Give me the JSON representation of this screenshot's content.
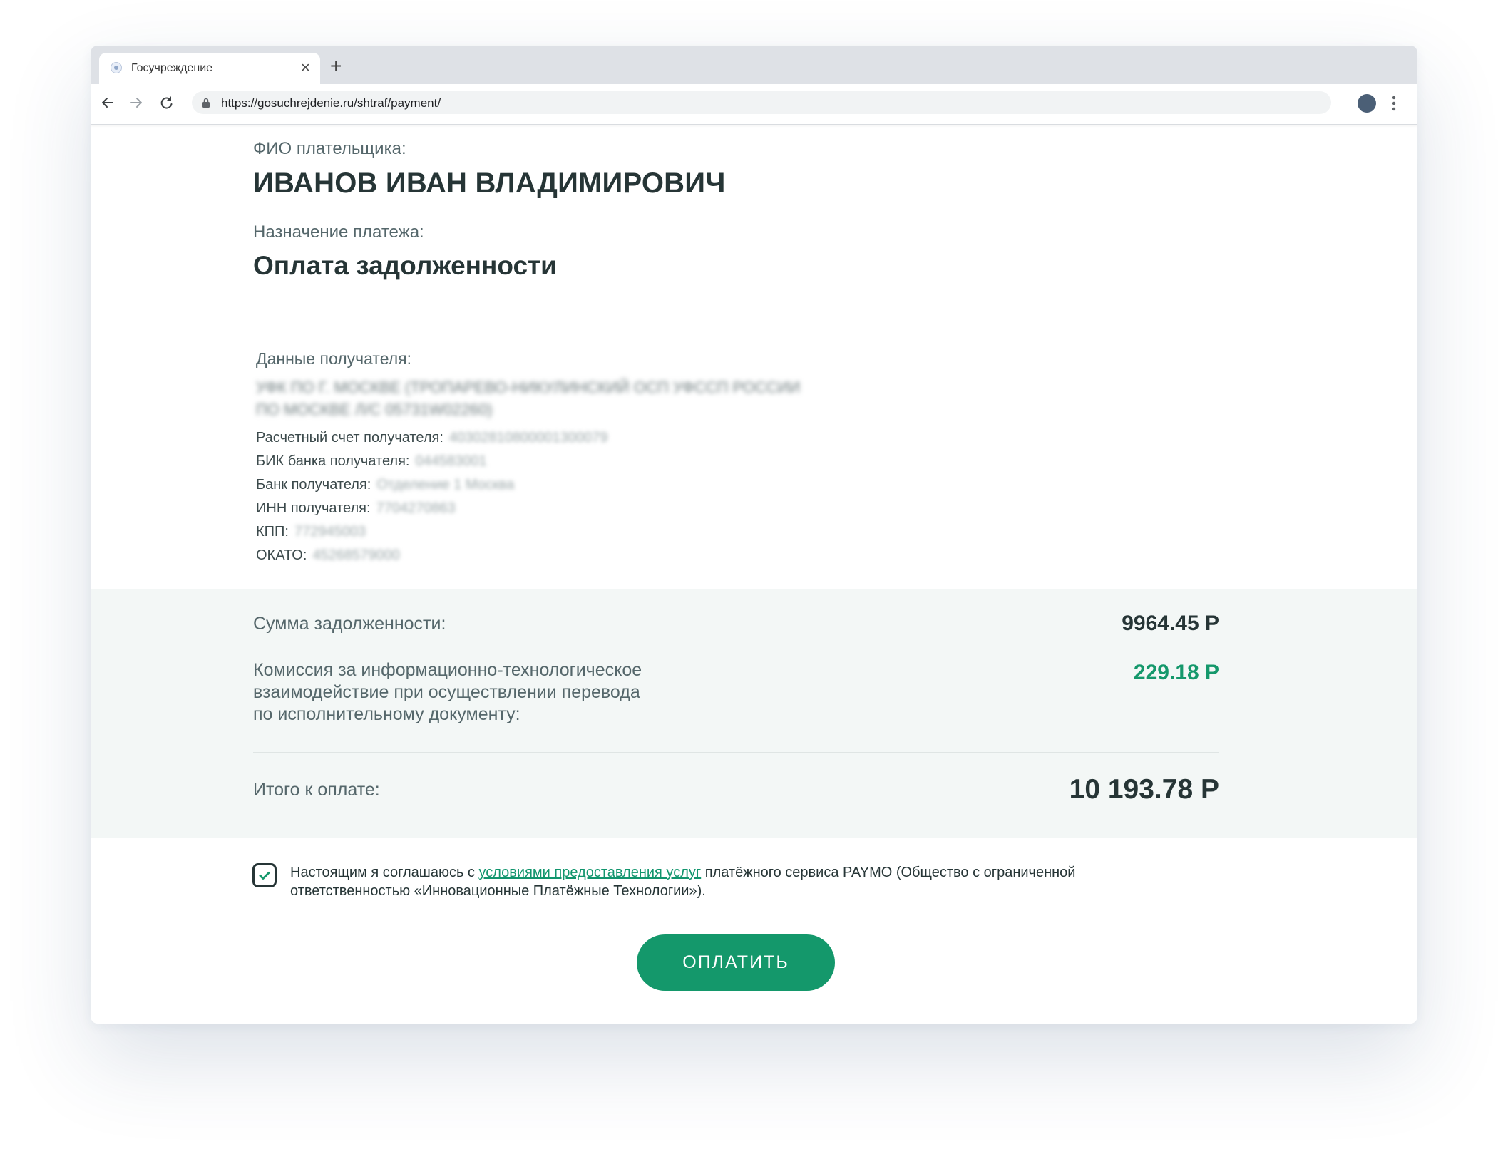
{
  "browser": {
    "tab_title": "Госучреждение",
    "tab_close": "×",
    "new_tab": "+",
    "url": "https://gosuchrejdenie.ru/shtraf/payment/"
  },
  "payer": {
    "label": "ФИО плательщика:",
    "name": "ИВАНОВ ИВАН ВЛАДИМИРОВИЧ"
  },
  "purpose": {
    "label": "Назначение платежа:",
    "value": "Оплата задолженности"
  },
  "recipient": {
    "title": "Данные получателя:",
    "name_line1": "УФК ПО Г. МОСКВЕ (ТРОПАРЕВО-НИКУЛИНСКИЙ ОСП УФССП РОССИИ",
    "name_line2": "ПО МОСКВЕ Л/С 05731W02260)",
    "fields": [
      {
        "label": "Расчетный счет получателя:",
        "value": "40302810800001300079"
      },
      {
        "label": "БИК банка получателя:",
        "value": "044583001"
      },
      {
        "label": "Банк получателя:",
        "value": "Отделение 1 Москва"
      },
      {
        "label": "ИНН получателя:",
        "value": "7704270863"
      },
      {
        "label": "КПП:",
        "value": "772945003"
      },
      {
        "label": "ОКАТО:",
        "value": "45268579000"
      }
    ]
  },
  "summary": {
    "debt_label": "Сумма задолженности:",
    "debt_value": "9964.45 Р",
    "commission_line1": "Комиссия за информационно-технологическое",
    "commission_line2": "взаимодействие при осуществлении перевода",
    "commission_line3": "по исполнительному документу:",
    "commission_value": "229.18 Р",
    "total_label": "Итого к оплате:",
    "total_value": "10 193.78 Р"
  },
  "agreement": {
    "checked": true,
    "text_before": "Настоящим я соглашаюсь с ",
    "link_text": "условиями предоставления услуг",
    "text_after": " платёжного сервиса PAYMO (Общество с ограниченной ответственностью «Инновационные Платёжные Технологии»)."
  },
  "pay_button_label": "ОПЛАТИТЬ",
  "colors": {
    "accent": "#14986b",
    "commission": "#14986b",
    "summary_bg": "#f3f7f6",
    "text_dark": "#263536"
  }
}
